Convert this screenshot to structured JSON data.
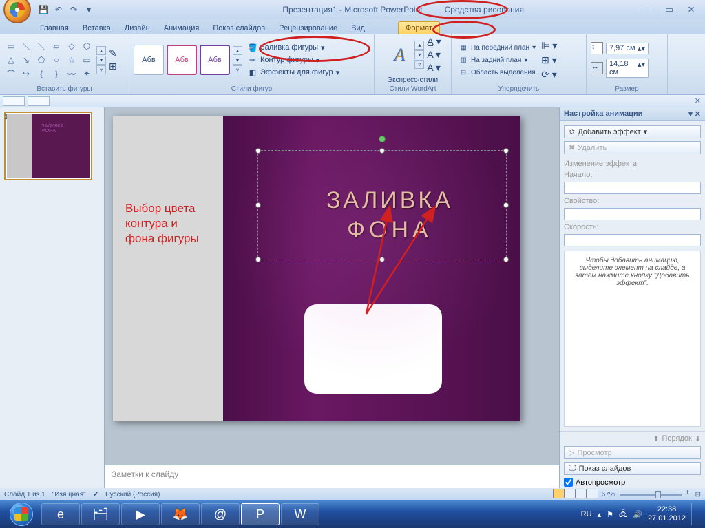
{
  "title": "Презентация1 - Microsoft PowerPoint",
  "tool_tab_title": "Средства рисования",
  "tabs": [
    "Главная",
    "Вставка",
    "Дизайн",
    "Анимация",
    "Показ слайдов",
    "Рецензирование",
    "Вид"
  ],
  "active_context_tab": "Формат",
  "ribbon": {
    "insert_shapes": "Вставить фигуры",
    "shape_styles": "Стили фигур",
    "wordart_styles": "Стили WordArt",
    "arrange": "Упорядочить",
    "size": "Размер",
    "style_label": "Абв",
    "fill": "Заливка фигуры",
    "outline": "Контур фигуры",
    "effects": "Эффекты для фигур",
    "express": "Экспресс-стили",
    "bring_front": "На передний план",
    "send_back": "На задний план",
    "selection_pane": "Область выделения",
    "height": "7,97 см",
    "width": "14,18 см"
  },
  "annotation": "Выбор цвета контура и фона фигуры",
  "slide_title_l1": "ЗАЛИВКА",
  "slide_title_l2": "ФОНА",
  "notes_placeholder": "Заметки к слайду",
  "anim": {
    "title": "Настройка анимации",
    "add_effect": "Добавить эффект",
    "delete": "Удалить",
    "change": "Изменение эффекта",
    "start": "Начало:",
    "property": "Свойство:",
    "speed": "Скорость:",
    "hint": "Чтобы добавить анимацию, выделите элемент на слайде, а затем нажмите кнопку \"Добавить эффект\".",
    "order": "Порядок",
    "preview": "Просмотр",
    "slideshow": "Показ слайдов",
    "autopreview": "Автопросмотр"
  },
  "status": {
    "slide": "Слайд 1 из 1",
    "theme": "\"Изящная\"",
    "lang": "Русский (Россия)",
    "zoom": "67%"
  },
  "tray": {
    "lang": "RU",
    "time": "22:38",
    "date": "27.01.2012"
  }
}
